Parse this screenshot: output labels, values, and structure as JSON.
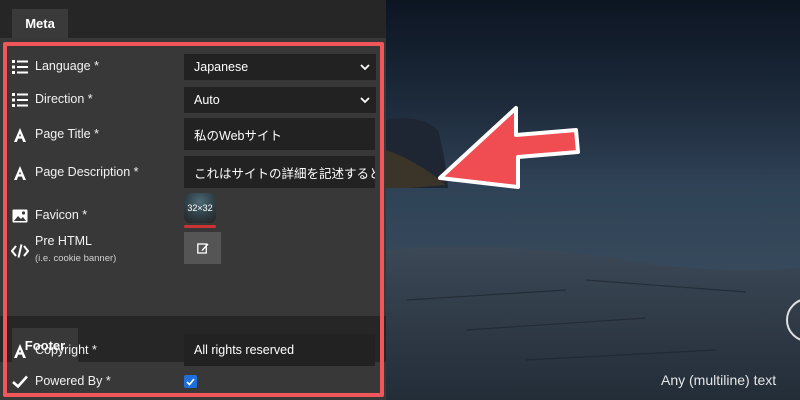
{
  "meta_tab": {
    "label": "Meta"
  },
  "fields": {
    "language": {
      "label": "Language *",
      "value": "Japanese"
    },
    "direction": {
      "label": "Direction *",
      "value": "Auto"
    },
    "page_title": {
      "label": "Page Title *",
      "value": "私のWebサイト"
    },
    "page_description": {
      "label": "Page Description *",
      "value": "これはサイトの詳細を記述すると"
    },
    "favicon": {
      "label": "Favicon *",
      "value": "32×32"
    },
    "pre_html": {
      "label": "Pre HTML",
      "sublabel": "(i.e. cookie banner)"
    }
  },
  "footer_tab": {
    "label": "Footer"
  },
  "footer_fields": {
    "copyright": {
      "label": "Copyright *",
      "value": "All rights reserved"
    },
    "powered_by": {
      "label": "Powered By *",
      "checked": true
    }
  },
  "preview": {
    "caption": "Any (multiline) text"
  },
  "colors": {
    "highlight": "#f0565a",
    "accent_check": "#1e6fd9",
    "arrow": "#ef4d52"
  }
}
